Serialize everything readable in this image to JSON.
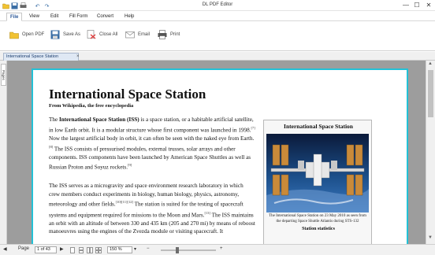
{
  "window": {
    "title": "DL PDF Editor",
    "minimize": "—",
    "maximize": "☐",
    "close": "✕"
  },
  "quick_access": [
    {
      "name": "open-file-icon"
    },
    {
      "name": "save-icon"
    },
    {
      "name": "print-icon"
    },
    {
      "name": "undo-icon",
      "glyph": "↶"
    },
    {
      "name": "redo-icon",
      "glyph": "↷"
    }
  ],
  "menu": [
    "File",
    "View",
    "Edit",
    "Fill Form",
    "Convert",
    "Help"
  ],
  "ribbon": {
    "open_pdf": "Open PDF",
    "save_as": "Save As",
    "close_all": "Close All",
    "email": "Email",
    "print": "Print"
  },
  "doc_tab": {
    "label": "International Space Station",
    "close": "×"
  },
  "side_panel": {
    "pages_tab": "Pages"
  },
  "document": {
    "title": "International Space Station",
    "subtitle": "From Wikipedia, the free encyclopedia",
    "para1": {
      "t1": "The ",
      "bold": "International Space Station (ISS)",
      "t2": " is a space station, or a habitable artificial satellite, in low Earth orbit. It is a modular structure whose first component was launched in 1998.",
      "ref1": "[7]",
      "t3": " Now the largest artificial body in orbit, it can often be seen with the naked eye from Earth.",
      "ref2": "[8]",
      "t4": " The ISS consists of pressurised modules, external trusses, solar arrays and other components. ISS components have been launched by American Space Shuttles as well as Russian Proton and Soyuz rockets.",
      "ref3": "[9]"
    },
    "para2": {
      "t1": "The ISS serves as a microgravity and space environment research laboratory in which crew members conduct experiments in biology, human biology, physics, astronomy, meteorology and other fields.",
      "ref1": "[10][11][12]",
      "t2": " The station is suited for the testing of spacecraft systems and equipment required for missions to the Moon and Mars.",
      "ref2": "[13]",
      "t3": " The ISS maintains an orbit with an altitude of between 330 and 435 km (205 and 270 mi) by means of reboost manoeuvres using the engines of the Zvezda module or visiting spacecraft. It"
    },
    "infobox": {
      "title": "International Space Station",
      "caption": "The International Space Station on 23 May 2010 as seen from the departing Space Shuttle Atlantis during STS-132",
      "stats_heading": "Station statistics"
    }
  },
  "status_bar": {
    "page_label": "Page",
    "page_value": "1 of 43",
    "zoom_value": "150 %",
    "zoom_out": "−",
    "zoom_in": "+"
  },
  "colors": {
    "accent": "#2b5797",
    "page_border": "#23c1d6",
    "viewer_bg": "#9d9d9d"
  }
}
